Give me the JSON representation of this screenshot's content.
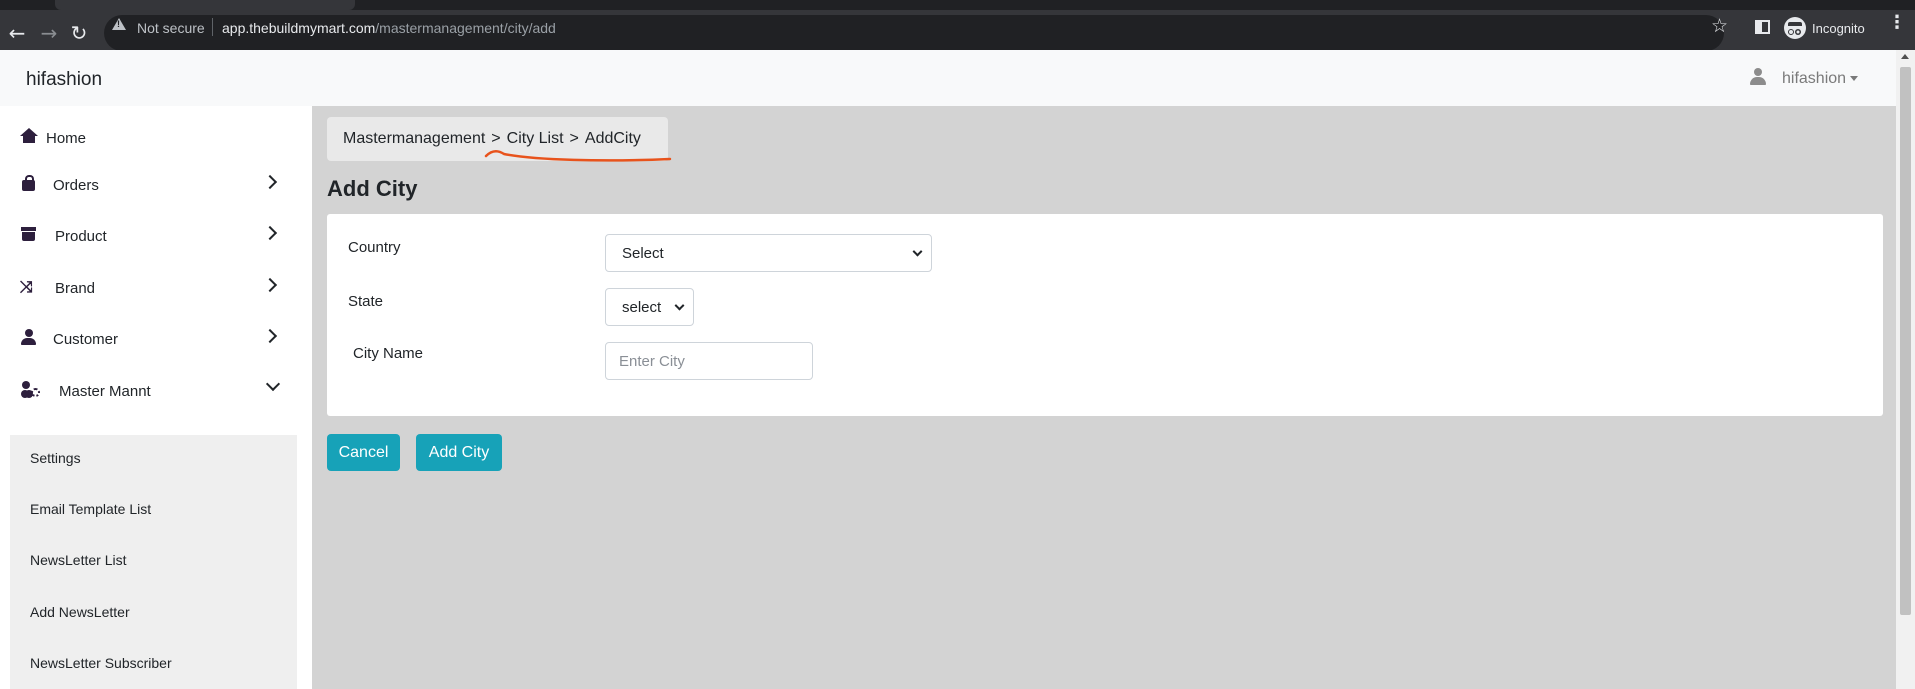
{
  "browser": {
    "security_label": "Not secure",
    "url_host": "app.thebuildmymart.com",
    "url_path": "/mastermanagement/city/add",
    "incognito_label": "Incognito"
  },
  "navbar": {
    "brand": "hifashion",
    "user_name": "hifashion"
  },
  "sidebar": {
    "items": [
      {
        "label": "Home",
        "icon": "home-icon"
      },
      {
        "label": "Orders",
        "icon": "shopping-bag-icon"
      },
      {
        "label": "Product",
        "icon": "archive-icon"
      },
      {
        "label": "Brand",
        "icon": "shuffle-icon"
      },
      {
        "label": "Customer",
        "icon": "person-icon"
      },
      {
        "label": "Master Mannt",
        "icon": "user-gear-icon"
      }
    ],
    "submenu": [
      "Settings",
      "Email Template List",
      "NewsLetter List",
      "Add NewsLetter",
      "NewsLetter Subscriber"
    ]
  },
  "breadcrumb": {
    "items": [
      "Mastermanagement",
      "City List",
      "AddCity"
    ],
    "separator": ">"
  },
  "annotation_color": "#e8531c",
  "page_title": "Add City",
  "form": {
    "country_label": "Country",
    "country_value": "Select",
    "state_label": "State",
    "state_value": "select",
    "city_label": "City Name",
    "city_placeholder": "Enter City",
    "city_value": ""
  },
  "buttons": {
    "cancel": "Cancel",
    "add": "Add City"
  },
  "colors": {
    "primary_button": "#17a2b8",
    "content_background": "#d3d3d3",
    "navbar_background": "#f8f9fa"
  }
}
